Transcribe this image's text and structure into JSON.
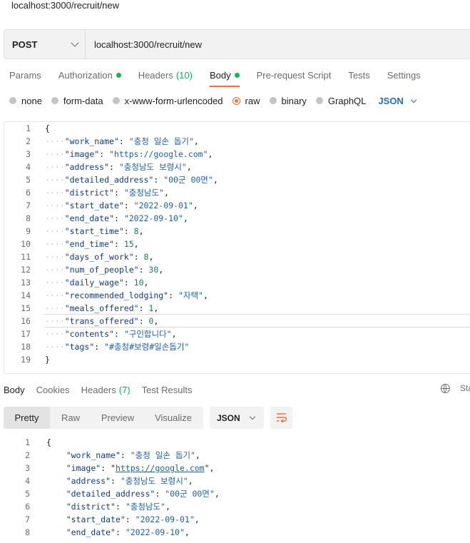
{
  "window": {
    "title": "localhost:3000/recruit/new"
  },
  "request": {
    "method": "POST",
    "url": "localhost:3000/recruit/new",
    "tabs": [
      {
        "label": "Params"
      },
      {
        "label": "Authorization",
        "dot": true
      },
      {
        "label": "Headers",
        "count": "(10)"
      },
      {
        "label": "Body",
        "dot": true,
        "active": true
      },
      {
        "label": "Pre-request Script"
      },
      {
        "label": "Tests"
      },
      {
        "label": "Settings"
      }
    ],
    "body_types": [
      {
        "label": "none"
      },
      {
        "label": "form-data"
      },
      {
        "label": "x-www-form-urlencoded"
      },
      {
        "label": "raw",
        "selected": true
      },
      {
        "label": "binary"
      },
      {
        "label": "GraphQL"
      }
    ],
    "language": "JSON",
    "body_lines": [
      {
        "n": "1",
        "key": "",
        "val": "",
        "type": "open"
      },
      {
        "n": "2",
        "key": "work_name",
        "val": "\"충청 일손 돕기\"",
        "type": "str"
      },
      {
        "n": "3",
        "key": "image",
        "val": "\"https://google.com\"",
        "type": "str"
      },
      {
        "n": "4",
        "key": "address",
        "val": "\"충청남도 보령시\"",
        "type": "str"
      },
      {
        "n": "5",
        "key": "detailed_address",
        "val": "\"00군 00면\"",
        "type": "str"
      },
      {
        "n": "6",
        "key": "district",
        "val": "\"충청남도\"",
        "type": "str"
      },
      {
        "n": "7",
        "key": "start_date",
        "val": "\"2022-09-01\"",
        "type": "str"
      },
      {
        "n": "8",
        "key": "end_date",
        "val": "\"2022-09-10\"",
        "type": "str"
      },
      {
        "n": "9",
        "key": "start_time",
        "val": "8",
        "type": "num"
      },
      {
        "n": "10",
        "key": "end_time",
        "val": "15",
        "type": "num"
      },
      {
        "n": "11",
        "key": "days_of_work",
        "val": "8",
        "type": "num"
      },
      {
        "n": "12",
        "key": "num_of_people",
        "val": "30",
        "type": "num"
      },
      {
        "n": "13",
        "key": "daily_wage",
        "val": "10",
        "type": "num"
      },
      {
        "n": "14",
        "key": "recommended_lodging",
        "val": "\"자택\"",
        "type": "str"
      },
      {
        "n": "15",
        "key": "meals_offered",
        "val": "1",
        "type": "num"
      },
      {
        "n": "16",
        "key": "trans_offered",
        "val": "0",
        "type": "num"
      },
      {
        "n": "17",
        "key": "contents",
        "val": "\"구인합니다\"",
        "type": "str"
      },
      {
        "n": "18",
        "key": "tags",
        "val": "\"#충청#보령#일손돕기\"",
        "type": "str",
        "last": true
      },
      {
        "n": "19",
        "key": "",
        "val": "",
        "type": "close"
      }
    ]
  },
  "response": {
    "tabs": [
      {
        "label": "Body",
        "active": true
      },
      {
        "label": "Cookies"
      },
      {
        "label": "Headers",
        "count": "(7)"
      },
      {
        "label": "Test Results"
      }
    ],
    "status_cut": "Sta",
    "view_modes": [
      {
        "label": "Pretty",
        "active": true
      },
      {
        "label": "Raw"
      },
      {
        "label": "Preview"
      },
      {
        "label": "Visualize"
      }
    ],
    "format": "JSON",
    "body_lines": [
      {
        "n": "1",
        "key": "",
        "val": "",
        "type": "open"
      },
      {
        "n": "2",
        "key": "work_name",
        "val": "\"충청 일손 돕기\"",
        "type": "str"
      },
      {
        "n": "3",
        "key": "image",
        "val": "https://google.com",
        "type": "link"
      },
      {
        "n": "4",
        "key": "address",
        "val": "\"충청남도 보령시\"",
        "type": "str"
      },
      {
        "n": "5",
        "key": "detailed_address",
        "val": "\"00군 00면\"",
        "type": "str"
      },
      {
        "n": "6",
        "key": "district",
        "val": "\"충청남도\"",
        "type": "str"
      },
      {
        "n": "7",
        "key": "start_date",
        "val": "\"2022-09-01\"",
        "type": "str"
      },
      {
        "n": "8",
        "key": "end_date",
        "val": "\"2022-09-10\"",
        "type": "str"
      }
    ]
  }
}
